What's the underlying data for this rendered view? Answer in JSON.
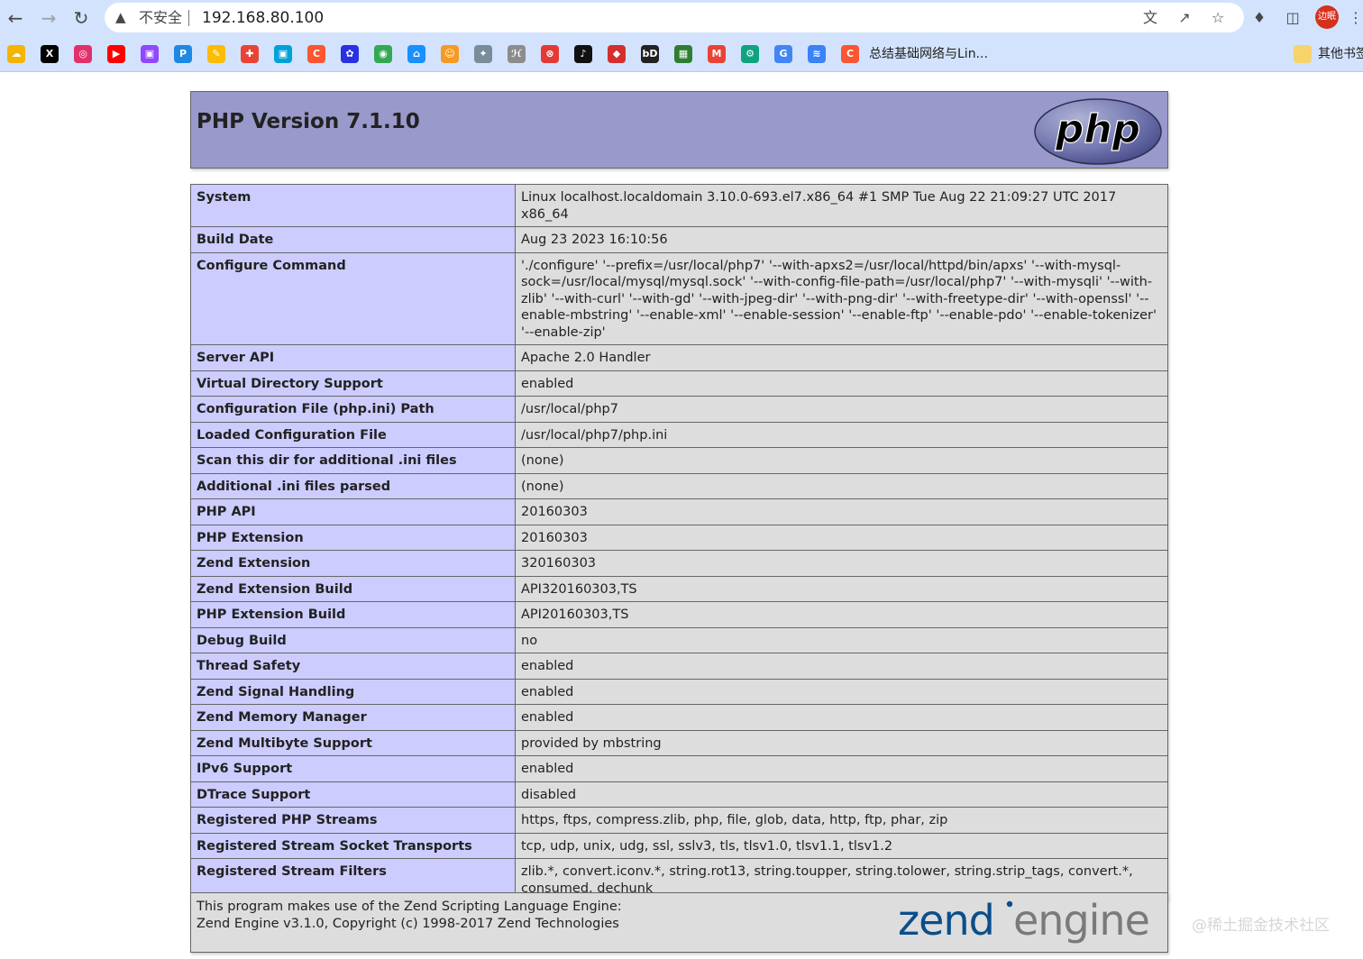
{
  "browser": {
    "nav": {
      "back_icon": "arrow-left-icon",
      "forward_icon": "arrow-right-icon",
      "reload_icon": "reload-icon"
    },
    "omnibox": {
      "security_label": "不安全",
      "url": "192.168.80.100"
    },
    "avatar_label": "边眠"
  },
  "bookmarks": {
    "items": [
      {
        "icon": "rainbow-icon",
        "color": "#f4b400"
      },
      {
        "icon": "x-icon",
        "color": "#000000"
      },
      {
        "icon": "instagram-icon",
        "color": "#e1306c"
      },
      {
        "icon": "youtube-icon",
        "color": "#ff0000"
      },
      {
        "icon": "twitch-icon",
        "color": "#9146ff"
      },
      {
        "icon": "p-icon",
        "color": "#1e88e5"
      },
      {
        "icon": "notes-icon",
        "color": "#fbbc04"
      },
      {
        "icon": "puzzle-icon",
        "color": "#ea4335"
      },
      {
        "icon": "bilibili-icon",
        "color": "#00a1d6"
      },
      {
        "icon": "csdn-icon",
        "color": "#fc5531"
      },
      {
        "icon": "baidu-icon",
        "color": "#2932e1"
      },
      {
        "icon": "chrome-icon",
        "color": "#34a853"
      },
      {
        "icon": "cloud-icon",
        "color": "#1890ff"
      },
      {
        "icon": "cat-icon",
        "color": "#f59a23"
      },
      {
        "icon": "bird-icon",
        "color": "#7a8b99"
      },
      {
        "icon": "script-icon",
        "color": "#8c8c8c"
      },
      {
        "icon": "circle-x-icon",
        "color": "#e53935"
      },
      {
        "icon": "tiktok-icon",
        "color": "#111111"
      },
      {
        "icon": "box-icon",
        "color": "#d32f2f"
      },
      {
        "icon": "btd-icon",
        "color": "#222222"
      },
      {
        "icon": "grid-icon",
        "color": "#2e7d32"
      },
      {
        "icon": "gmail-icon",
        "color": "#ea4335"
      },
      {
        "icon": "openai-icon",
        "color": "#10a37f"
      },
      {
        "icon": "google-icon",
        "color": "#4285f4"
      },
      {
        "icon": "layers-icon",
        "color": "#3b82f6"
      },
      {
        "icon": "csdn-c-icon",
        "color": "#fc5531"
      }
    ],
    "last_label": "总结基础网络与Lin...",
    "other_label": "其他书签"
  },
  "php": {
    "title": "PHP Version 7.1.10",
    "logo_text": "php",
    "rows": [
      {
        "key": "System",
        "value": "Linux localhost.localdomain 3.10.0-693.el7.x86_64 #1 SMP Tue Aug 22 21:09:27 UTC 2017 x86_64"
      },
      {
        "key": "Build Date",
        "value": "Aug 23 2023 16:10:56"
      },
      {
        "key": "Configure Command",
        "value": "'./configure' '--prefix=/usr/local/php7' '--with-apxs2=/usr/local/httpd/bin/apxs' '--with-mysql-sock=/usr/local/mysql/mysql.sock' '--with-config-file-path=/usr/local/php7' '--with-mysqli' '--with-zlib' '--with-curl' '--with-gd' '--with-jpeg-dir' '--with-png-dir' '--with-freetype-dir' '--with-openssl' '--enable-mbstring' '--enable-xml' '--enable-session' '--enable-ftp' '--enable-pdo' '--enable-tokenizer' '--enable-zip'"
      },
      {
        "key": "Server API",
        "value": "Apache 2.0 Handler"
      },
      {
        "key": "Virtual Directory Support",
        "value": "enabled"
      },
      {
        "key": "Configuration File (php.ini) Path",
        "value": "/usr/local/php7"
      },
      {
        "key": "Loaded Configuration File",
        "value": "/usr/local/php7/php.ini"
      },
      {
        "key": "Scan this dir for additional .ini files",
        "value": "(none)"
      },
      {
        "key": "Additional .ini files parsed",
        "value": "(none)"
      },
      {
        "key": "PHP API",
        "value": "20160303"
      },
      {
        "key": "PHP Extension",
        "value": "20160303"
      },
      {
        "key": "Zend Extension",
        "value": "320160303"
      },
      {
        "key": "Zend Extension Build",
        "value": "API320160303,TS"
      },
      {
        "key": "PHP Extension Build",
        "value": "API20160303,TS"
      },
      {
        "key": "Debug Build",
        "value": "no"
      },
      {
        "key": "Thread Safety",
        "value": "enabled"
      },
      {
        "key": "Zend Signal Handling",
        "value": "enabled"
      },
      {
        "key": "Zend Memory Manager",
        "value": "enabled"
      },
      {
        "key": "Zend Multibyte Support",
        "value": "provided by mbstring"
      },
      {
        "key": "IPv6 Support",
        "value": "enabled"
      },
      {
        "key": "DTrace Support",
        "value": "disabled"
      },
      {
        "key": "Registered PHP Streams",
        "value": "https, ftps, compress.zlib, php, file, glob, data, http, ftp, phar, zip"
      },
      {
        "key": "Registered Stream Socket Transports",
        "value": "tcp, udp, unix, udg, ssl, sslv3, tls, tlsv1.0, tlsv1.1, tlsv1.2"
      },
      {
        "key": "Registered Stream Filters",
        "value": "zlib.*, convert.iconv.*, string.rot13, string.toupper, string.tolower, string.strip_tags, convert.*, consumed, dechunk"
      }
    ]
  },
  "zend": {
    "line1": "This program makes use of the Zend Scripting Language Engine:",
    "line2": "Zend Engine v3.1.0, Copyright (c) 1998-2017 Zend Technologies",
    "logo_word1": "zend",
    "logo_word2": "engine"
  },
  "watermark": "@稀土掘金技术社区"
}
